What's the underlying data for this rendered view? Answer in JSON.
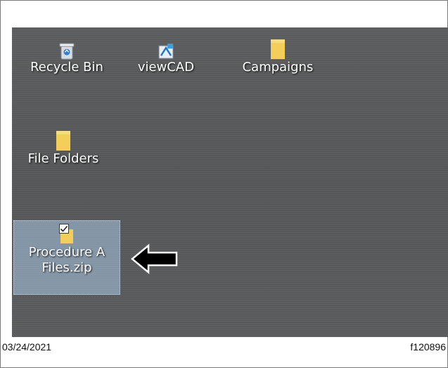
{
  "desktop": {
    "icons": [
      {
        "label": "Recycle Bin",
        "icon": "recycle-bin-icon"
      },
      {
        "label": "viewCAD",
        "icon": "viewcad-app-icon"
      },
      {
        "label": "Campaigns",
        "icon": "folder-icon"
      },
      {
        "label": "File Folders",
        "icon": "folder-icon"
      },
      {
        "label_line1": "Procedure A",
        "label_line2": "Files.zip",
        "icon": "zip-folder-icon",
        "selected": true,
        "checked": true
      }
    ]
  },
  "annotation": {
    "arrow": "left-arrow-callout"
  },
  "footer": {
    "date": "03/24/2021",
    "figure_id": "f120896"
  },
  "colors": {
    "desktop": "#58595a",
    "folder": "#f3cf5a",
    "selection": "#aac8e6"
  }
}
